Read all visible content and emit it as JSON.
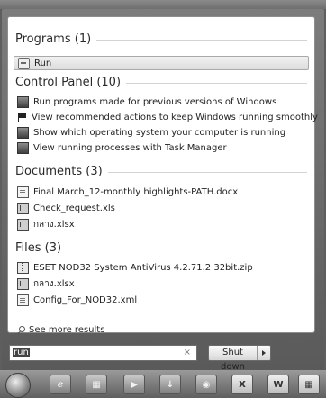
{
  "programs": {
    "header": "Programs (1)",
    "items": [
      {
        "label": "Run",
        "icon": "run-icon"
      }
    ]
  },
  "control_panel": {
    "header": "Control Panel (10)",
    "items": [
      {
        "label": "Run programs made for previous versions of Windows",
        "icon": "control-panel-icon"
      },
      {
        "label": "View recommended actions to keep Windows running smoothly",
        "icon": "flag-icon"
      },
      {
        "label": "Show which operating system your computer is running",
        "icon": "control-panel-icon"
      },
      {
        "label": "View running processes with Task Manager",
        "icon": "control-panel-icon"
      }
    ]
  },
  "documents": {
    "header": "Documents (3)",
    "items": [
      {
        "label": "Final March_12-monthly highlights-PATH.docx",
        "icon": "word-doc-icon"
      },
      {
        "label": "Check_request.xls",
        "icon": "excel-icon"
      },
      {
        "label": "กลาง.xlsx",
        "icon": "excel-icon"
      }
    ]
  },
  "files": {
    "header": "Files (3)",
    "items": [
      {
        "label": "ESET NOD32 System AntiVirus 4.2.71.2 32bit.zip",
        "icon": "zip-icon"
      },
      {
        "label": "กลาง.xlsx",
        "icon": "excel-icon"
      },
      {
        "label": "Config_For_NOD32.xml",
        "icon": "xml-file-icon"
      }
    ]
  },
  "see_more": "See more results",
  "search": {
    "value": "run",
    "clear_glyph": "×"
  },
  "shutdown": {
    "label": "Shut down"
  },
  "taskbar": {
    "items": [
      "start-orb",
      "ie-icon",
      "explorer-icon",
      "media-player-icon",
      "download-icon",
      "app-icon",
      "excel-taskbar-icon",
      "word-taskbar-icon",
      "calculator-icon"
    ],
    "labels": {
      "excel": "X",
      "word": "W"
    }
  },
  "colors": {
    "menu_bg": "#6b6b6b",
    "panel_bg": "#ffffff",
    "selection": "#e4e4e4"
  }
}
